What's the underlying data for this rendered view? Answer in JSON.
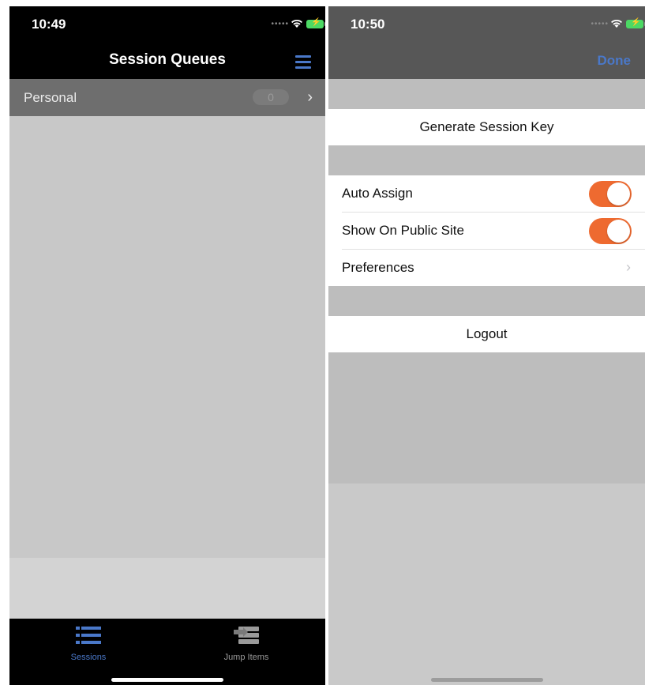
{
  "left_screen": {
    "status": {
      "time": "10:49"
    },
    "nav": {
      "title": "Session Queues",
      "menu_icon": "hamburger-menu-icon"
    },
    "queue_rows": [
      {
        "label": "Personal",
        "count": "0"
      }
    ],
    "tabbar": {
      "tabs": [
        {
          "label": "Sessions",
          "icon": "list-icon",
          "selected": true
        },
        {
          "label": "Jump Items",
          "icon": "jump-items-icon",
          "selected": false
        }
      ]
    }
  },
  "right_screen": {
    "status": {
      "time": "10:50"
    },
    "nav": {
      "done_label": "Done"
    },
    "sections": {
      "generate_label": "Generate Session Key",
      "auto_assign": {
        "label": "Auto Assign",
        "on": true
      },
      "show_public": {
        "label": "Show On Public Site",
        "on": true
      },
      "preferences_label": "Preferences",
      "logout_label": "Logout"
    }
  },
  "colors": {
    "accent": "#4a78c9",
    "toggle_on": "#ee6a30",
    "battery": "#4cd964"
  }
}
